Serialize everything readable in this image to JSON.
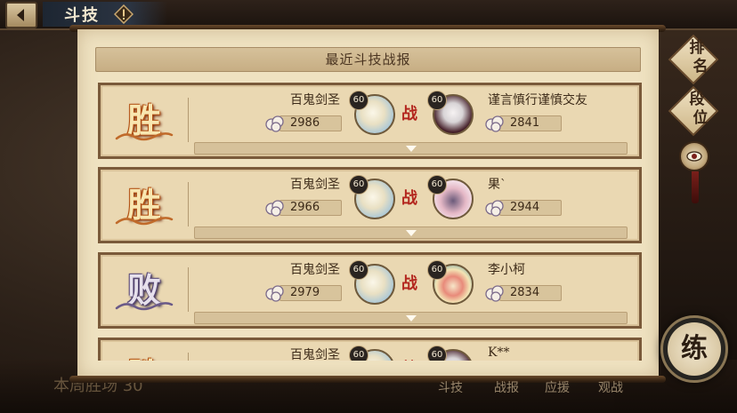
{
  "header": {
    "title": "斗技",
    "back_icon": "back-arrow-icon",
    "help_icon": "exclamation-icon"
  },
  "panel": {
    "title": "最近斗技战报"
  },
  "battles": [
    {
      "result": "胜",
      "result_type": "win",
      "player_name": "百鬼剑圣",
      "player_score": "2986",
      "player_level": "60",
      "vs": "战",
      "opponent_name": "谨言慎行谨慎交友",
      "opponent_score": "2841",
      "opponent_level": "60"
    },
    {
      "result": "胜",
      "result_type": "win",
      "player_name": "百鬼剑圣",
      "player_score": "2966",
      "player_level": "60",
      "vs": "战",
      "opponent_name": "果`",
      "opponent_score": "2944",
      "opponent_level": "60"
    },
    {
      "result": "败",
      "result_type": "lose",
      "player_name": "百鬼剑圣",
      "player_score": "2979",
      "player_level": "60",
      "vs": "战",
      "opponent_name": "李小柯",
      "opponent_score": "2834",
      "opponent_level": "60"
    },
    {
      "result": "胜",
      "result_type": "win",
      "player_name": "百鬼剑圣",
      "player_score": "",
      "player_level": "60",
      "vs": "战",
      "opponent_name": "K**",
      "opponent_score": "",
      "opponent_level": "60"
    }
  ],
  "side_buttons": {
    "rank": "排名",
    "tier": "段位",
    "train": "练"
  },
  "bottom_tabs": [
    "斗技",
    "战报",
    "应援",
    "观战"
  ],
  "bottom_left_text": "本周胜场 30",
  "colors": {
    "win": "#b85a18",
    "lose": "#5a4a78",
    "vs": "#b3261e",
    "parchment": "#efe2c1"
  }
}
